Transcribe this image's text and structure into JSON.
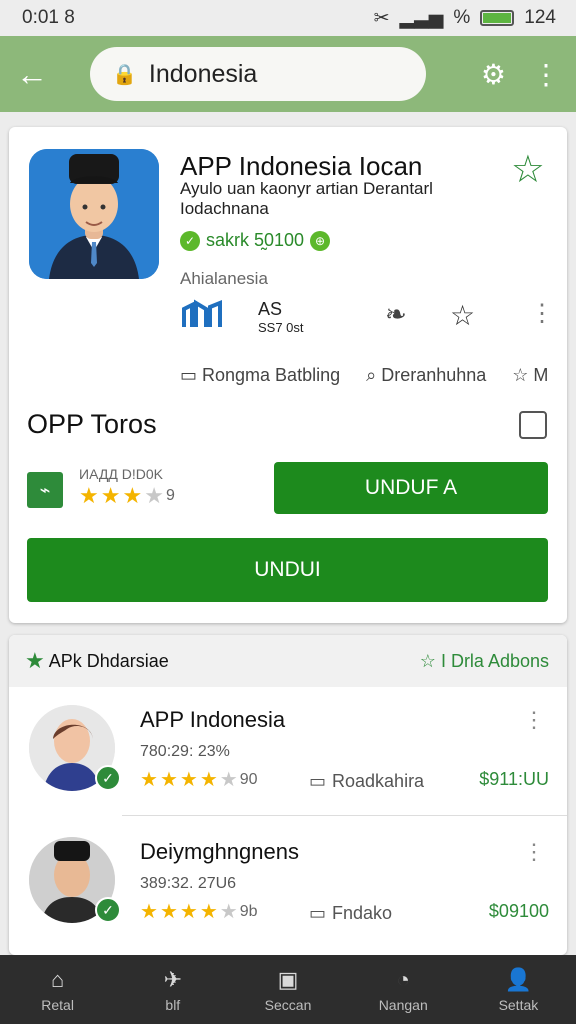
{
  "status": {
    "time": "0:01 8",
    "signal": "%",
    "battery": "124"
  },
  "topbar": {
    "url": "Indonesia"
  },
  "app": {
    "title": "APP Indonesia Iocan",
    "subtitle": "Ayulo uan kaonyr artian Derantarl Iodachnana",
    "price": "sakrk 5̰0100",
    "developer": "Ahialanesia",
    "icon_labels": {
      "stat_a": "AS",
      "stat_b": "SS7 0st"
    },
    "info_a": "Rongma Batbling",
    "info_b": "Dreranhuhna",
    "info_c": "M"
  },
  "section": {
    "title": "OPP Toros",
    "small_label": "ИАДД D!D0K",
    "rating_count": "9",
    "btn_small": "UNDUF A",
    "btn_large": "UNDUI"
  },
  "list": {
    "header_left": "APk Dhdarsiae",
    "header_right": "I Drla Adbons",
    "items": [
      {
        "title": "APP Indonesia",
        "sub": "780:29: 23%",
        "rating": "90",
        "tag": "Roadkahira",
        "price": "$911:UU"
      },
      {
        "title": "Deiymghngnens",
        "sub": "389:32. 27U6",
        "rating": "9b",
        "tag": "Fndako",
        "price": "$09100"
      }
    ]
  },
  "nav": [
    {
      "label": "Retal",
      "icon": "home-icon"
    },
    {
      "label": "blf",
      "icon": "plane-icon"
    },
    {
      "label": "Seccan",
      "icon": "card-icon"
    },
    {
      "label": "Nangan",
      "icon": "chat-icon"
    },
    {
      "label": "Settak",
      "icon": "person-icon"
    }
  ],
  "colors": {
    "green": "#1d8a1d",
    "top_bar": "#8db87a",
    "star": "#f4b400"
  }
}
